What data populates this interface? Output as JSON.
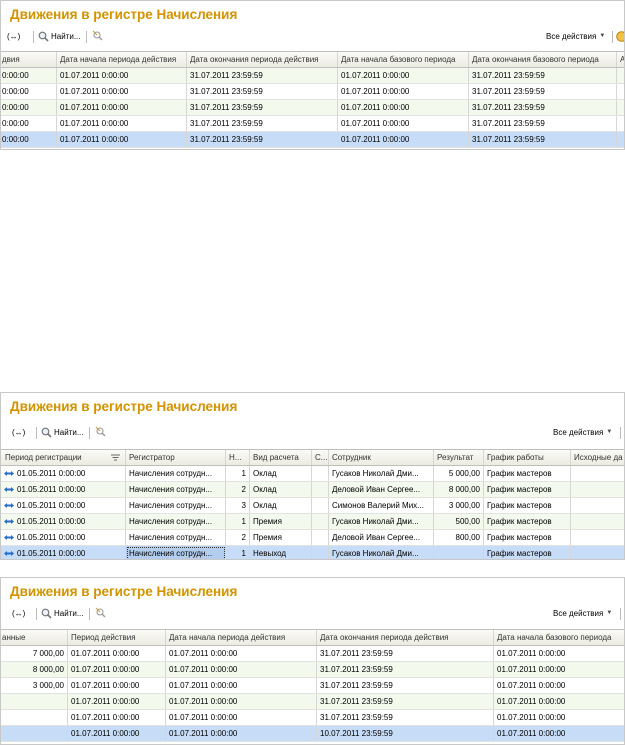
{
  "panel1": {
    "title": "Движения в регистре Начисления",
    "toolbar": {
      "nav_label": "(↔)",
      "find_label": "Найти...",
      "all_actions": "Все действия"
    },
    "columns": [
      "двия",
      "Дата начала периода действия",
      "Дата окончания периода действия",
      "Дата начала базового периода",
      "Дата окончания базового периода",
      "А"
    ],
    "rows": [
      [
        "0:00:00",
        "01.07.2011 0:00:00",
        "31.07.2011 23:59:59",
        "01.07.2011 0:00:00",
        "31.07.2011 23:59:59",
        ""
      ],
      [
        "0:00:00",
        "01.07.2011 0:00:00",
        "31.07.2011 23:59:59",
        "01.07.2011 0:00:00",
        "31.07.2011 23:59:59",
        ""
      ],
      [
        "0:00:00",
        "01.07.2011 0:00:00",
        "31.07.2011 23:59:59",
        "01.07.2011 0:00:00",
        "31.07.2011 23:59:59",
        ""
      ],
      [
        "0:00:00",
        "01.07.2011 0:00:00",
        "31.07.2011 23:59:59",
        "01.07.2011 0:00:00",
        "31.07.2011 23:59:59",
        ""
      ],
      [
        "0:00:00",
        "01.07.2011 0:00:00",
        "31.07.2011 23:59:59",
        "01.07.2011 0:00:00",
        "31.07.2011 23:59:59",
        ""
      ]
    ]
  },
  "panel2": {
    "title": "Движения в регистре Начисления",
    "toolbar": {
      "nav_label": "(↔)",
      "find_label": "Найти...",
      "all_actions": "Все действия"
    },
    "columns": [
      "Период регистрации",
      "Регистратор",
      "Н...",
      "Вид расчета",
      "С...",
      "Сотрудник",
      "Результат",
      "График работы",
      "Исходные да"
    ],
    "rows": [
      [
        "01.05.2011 0:00:00",
        "Начисления сотрудн...",
        "1",
        "Оклад",
        "",
        "Гусаков Николай Дми...",
        "5 000,00",
        "График мастеров",
        ""
      ],
      [
        "01.05.2011 0:00:00",
        "Начисления сотрудн...",
        "2",
        "Оклад",
        "",
        "Деловой Иван Сергее...",
        "8 000,00",
        "График мастеров",
        ""
      ],
      [
        "01.05.2011 0:00:00",
        "Начисления сотрудн...",
        "3",
        "Оклад",
        "",
        "Симонов Валерий Мих...",
        "3 000,00",
        "График мастеров",
        ""
      ],
      [
        "01.05.2011 0:00:00",
        "Начисления сотрудн...",
        "1",
        "Премия",
        "",
        "Гусаков Николай Дми...",
        "500,00",
        "График мастеров",
        ""
      ],
      [
        "01.05.2011 0:00:00",
        "Начисления сотрудн...",
        "2",
        "Премия",
        "",
        "Деловой Иван Сергее...",
        "800,00",
        "График мастеров",
        ""
      ],
      [
        "01.05.2011 0:00:00",
        "Начисления сотрудн...",
        "1",
        "Невыход",
        "",
        "Гусаков Николай Дми...",
        "",
        "График мастеров",
        ""
      ]
    ]
  },
  "panel3": {
    "title": "Движения в регистре Начисления",
    "toolbar": {
      "nav_label": "(↔)",
      "find_label": "Найти...",
      "all_actions": "Все действия"
    },
    "columns": [
      "анные",
      "Период действия",
      "Дата начала периода действия",
      "Дата окончания периода действия",
      "Дата начала базового периода"
    ],
    "rows": [
      [
        "7 000,00",
        "01.07.2011 0:00:00",
        "01.07.2011 0:00:00",
        "31.07.2011 23:59:59",
        "01.07.2011 0:00:00"
      ],
      [
        "8 000,00",
        "01.07.2011 0:00:00",
        "01.07.2011 0:00:00",
        "31.07.2011 23:59:59",
        "01.07.2011 0:00:00"
      ],
      [
        "3 000,00",
        "01.07.2011 0:00:00",
        "01.07.2011 0:00:00",
        "31.07.2011 23:59:59",
        "01.07.2011 0:00:00"
      ],
      [
        "",
        "01.07.2011 0:00:00",
        "01.07.2011 0:00:00",
        "31.07.2011 23:59:59",
        "01.07.2011 0:00:00"
      ],
      [
        "",
        "01.07.2011 0:00:00",
        "01.07.2011 0:00:00",
        "31.07.2011 23:59:59",
        "01.07.2011 0:00:00"
      ],
      [
        "",
        "01.07.2011 0:00:00",
        "01.07.2011 0:00:00",
        "10.07.2011 23:59:59",
        "01.07.2011 0:00:00"
      ]
    ]
  }
}
